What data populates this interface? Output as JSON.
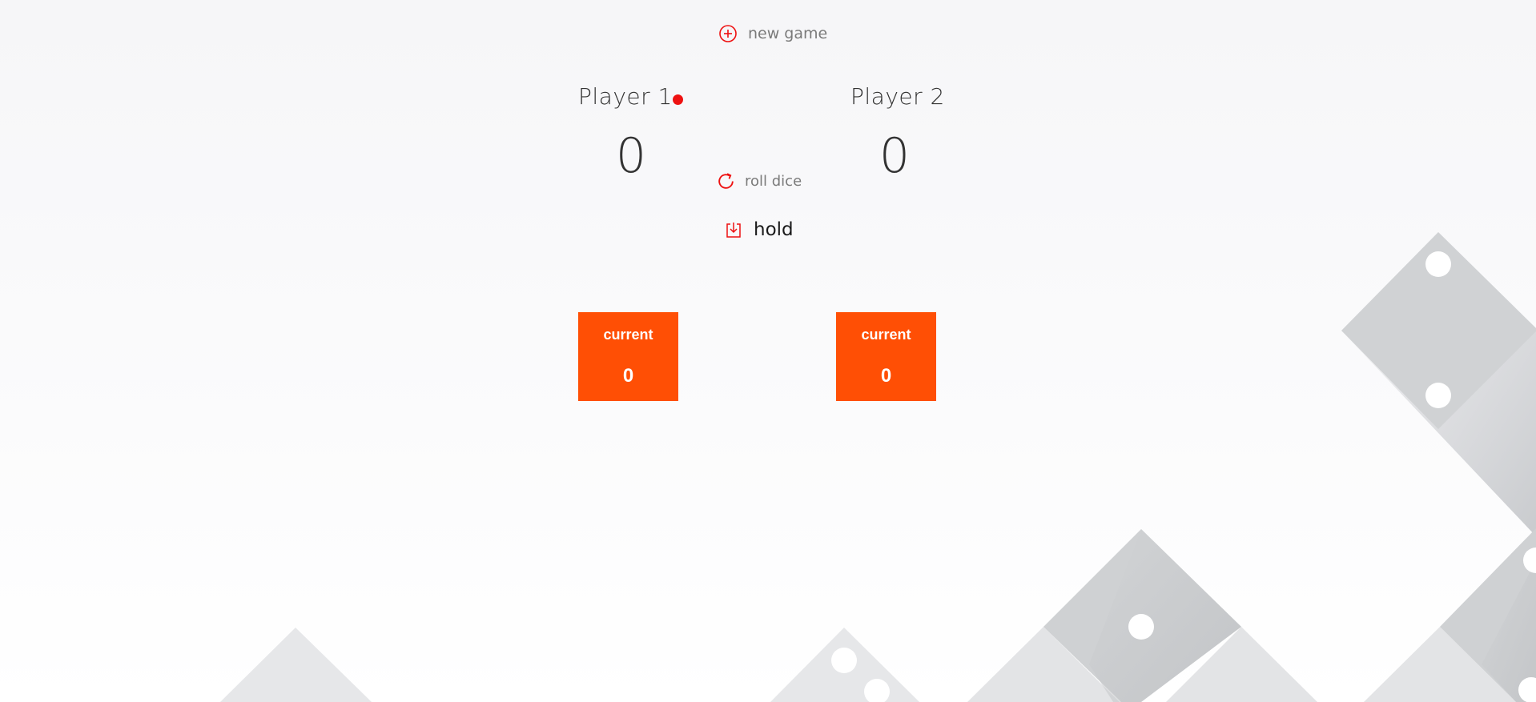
{
  "controls": {
    "new_game": "new game",
    "roll_dice": "roll dice",
    "hold": "hold"
  },
  "players": [
    {
      "name": "Player 1",
      "score": "0",
      "current_label": "current",
      "current_value": "0",
      "active": true
    },
    {
      "name": "Player 2",
      "score": "0",
      "current_label": "current",
      "current_value": "0",
      "active": false
    }
  ],
  "colors": {
    "accent": "#ee1111",
    "current_box": "#ff4f05",
    "text": "#333333",
    "control_text": "#7a7a7a",
    "dice_face": "#d0d2d4",
    "dice_light": "#e4e5e7",
    "pip": "#ffffff"
  },
  "icons": {
    "new_game": "plus-circle-icon",
    "roll_dice": "refresh-icon",
    "hold": "download-box-icon",
    "active_player": "dot-icon"
  }
}
